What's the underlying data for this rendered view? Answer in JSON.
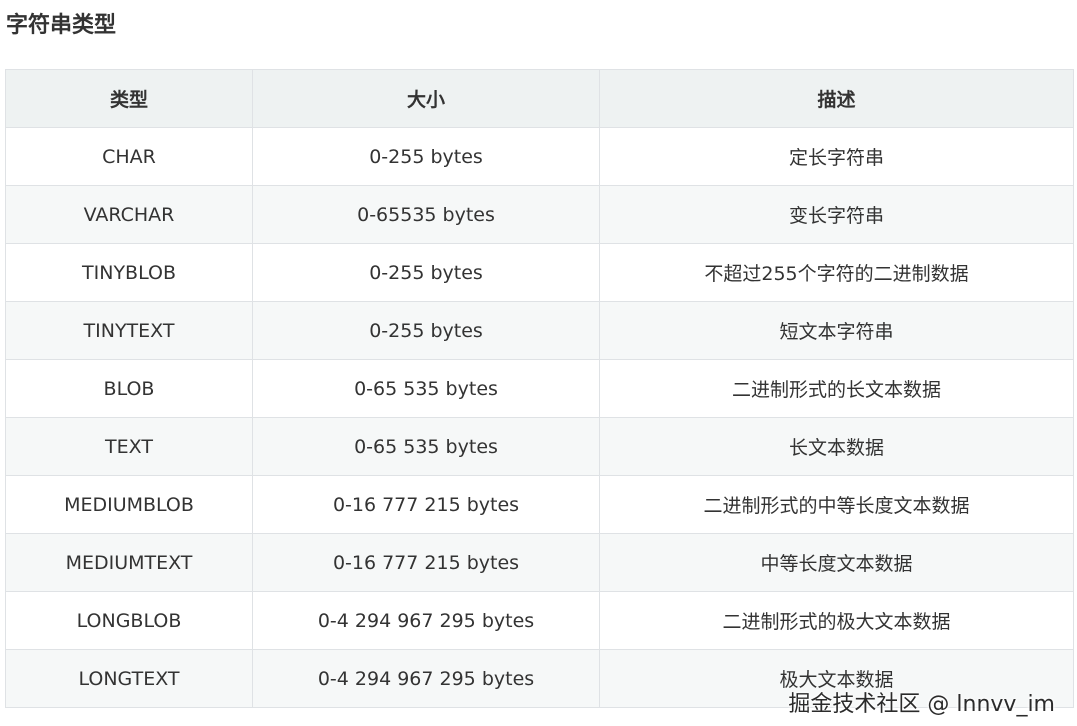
{
  "title": "字符串类型",
  "table": {
    "headers": [
      "类型",
      "大小",
      "描述"
    ],
    "rows": [
      {
        "type": "CHAR",
        "size": "0-255 bytes",
        "desc": "定长字符串"
      },
      {
        "type": "VARCHAR",
        "size": "0-65535 bytes",
        "desc": "变长字符串"
      },
      {
        "type": "TINYBLOB",
        "size": "0-255 bytes",
        "desc": "不超过255个字符的二进制数据"
      },
      {
        "type": "TINYTEXT",
        "size": "0-255 bytes",
        "desc": "短文本字符串"
      },
      {
        "type": "BLOB",
        "size": "0-65 535 bytes",
        "desc": "二进制形式的长文本数据"
      },
      {
        "type": "TEXT",
        "size": "0-65 535 bytes",
        "desc": "长文本数据"
      },
      {
        "type": "MEDIUMBLOB",
        "size": "0-16 777 215 bytes",
        "desc": "二进制形式的中等长度文本数据"
      },
      {
        "type": "MEDIUMTEXT",
        "size": "0-16 777 215 bytes",
        "desc": "中等长度文本数据"
      },
      {
        "type": "LONGBLOB",
        "size": "0-4 294 967 295 bytes",
        "desc": "二进制形式的极大文本数据"
      },
      {
        "type": "LONGTEXT",
        "size": "0-4 294 967 295 bytes",
        "desc": "极大文本数据"
      }
    ]
  },
  "watermark": "掘金技术社区 @ lnnvv_im"
}
